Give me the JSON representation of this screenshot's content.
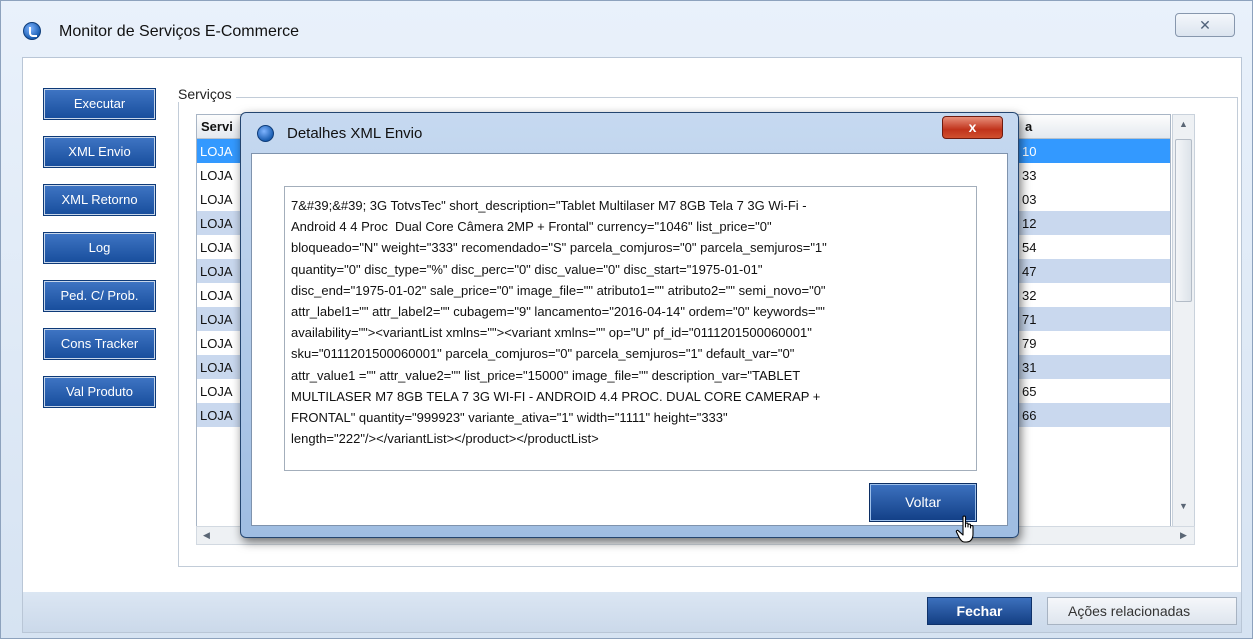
{
  "window": {
    "title": "Monitor de Serviços E-Commerce",
    "close_glyph": "✕"
  },
  "sidebar": {
    "buttons": [
      "Executar",
      "XML Envio",
      "XML Retorno",
      "Log",
      "Ped. C/ Prob.",
      "Cons Tracker",
      "Val Produto"
    ]
  },
  "services": {
    "group_label": "Serviços",
    "columns": [
      "Servi",
      "a"
    ],
    "rows": [
      {
        "c1": "LOJA",
        "c2": "10"
      },
      {
        "c1": "LOJA",
        "c2": "33"
      },
      {
        "c1": "LOJA",
        "c2": "03"
      },
      {
        "c1": "LOJA",
        "c2": "12"
      },
      {
        "c1": "LOJA",
        "c2": "54"
      },
      {
        "c1": "LOJA",
        "c2": "47"
      },
      {
        "c1": "LOJA",
        "c2": "32"
      },
      {
        "c1": "LOJA",
        "c2": "71"
      },
      {
        "c1": "LOJA",
        "c2": "79"
      },
      {
        "c1": "LOJA",
        "c2": "31"
      },
      {
        "c1": "LOJA",
        "c2": "65"
      },
      {
        "c1": "LOJA",
        "c2": "66"
      }
    ]
  },
  "footer": {
    "close_label": "Fechar",
    "actions_label": "Ações relacionadas"
  },
  "modal": {
    "title": "Detalhes XML Envio",
    "close_glyph": "x",
    "xml": "7&#39;&#39; 3G TotvsTec\" short_description=\"Tablet Multilaser M7 8GB Tela 7 3G Wi-Fi -\nAndroid 4 4 Proc  Dual Core Câmera 2MP + Frontal\" currency=\"1046\" list_price=\"0\"\nbloqueado=\"N\" weight=\"333\" recomendado=\"S\" parcela_comjuros=\"0\" parcela_semjuros=\"1\"\nquantity=\"0\" disc_type=\"%\" disc_perc=\"0\" disc_value=\"0\" disc_start=\"1975-01-01\"\ndisc_end=\"1975-01-02\" sale_price=\"0\" image_file=\"\" atributo1=\"\" atributo2=\"\" semi_novo=\"0\"\nattr_label1=\"\" attr_label2=\"\" cubagem=\"9\" lancamento=\"2016-04-14\" ordem=\"0\" keywords=\"\"\navailability=\"\"><variantList xmlns=\"\"><variant xmlns=\"\" op=\"U\" pf_id=\"0111201500060001\"\nsku=\"0111201500060001\" parcela_comjuros=\"0\" parcela_semjuros=\"1\" default_var=\"0\"\nattr_value1 =\"\" attr_value2=\"\" list_price=\"15000\" image_file=\"\" description_var=\"TABLET\nMULTILASER M7 8GB TELA 7 3G WI-FI - ANDROID 4.4 PROC. DUAL CORE CAMERAP +\nFRONTAL\" quantity=\"999923\" variante_ativa=\"1\" width=\"1111\" height=\"333\"\nlength=\"222\"/></variantList></product></productList>",
    "back_label": "Voltar"
  },
  "colors": {
    "selected_row": "#3399ff",
    "alt_row": "#c9d8ee",
    "button_blue": "#174d9c",
    "close_red": "#c0331b"
  }
}
